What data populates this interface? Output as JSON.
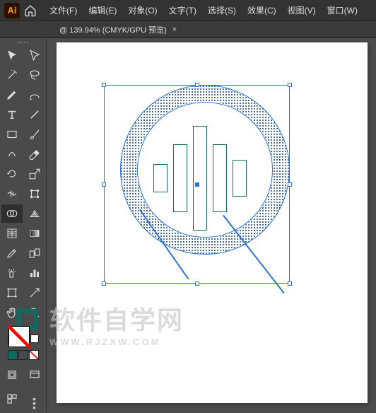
{
  "app": {
    "abbr": "Ai"
  },
  "menu": [
    {
      "label": "文件(F)"
    },
    {
      "label": "编辑(E)"
    },
    {
      "label": "对象(O)"
    },
    {
      "label": "文字(T)"
    },
    {
      "label": "选择(S)"
    },
    {
      "label": "效果(C)"
    },
    {
      "label": "视图(V)"
    },
    {
      "label": "窗口(W)"
    }
  ],
  "tab": {
    "title": "@ 139.94% (CMYK/GPU 预览)",
    "close": "×"
  },
  "swatches": [
    {
      "color": "#0f6b60"
    },
    {
      "color": "#4a4a4a"
    },
    {
      "color": "#ffffff",
      "diag": true
    }
  ],
  "watermark": {
    "line1": "软件自学网",
    "line2": "WWW.RJZXW.COM"
  }
}
